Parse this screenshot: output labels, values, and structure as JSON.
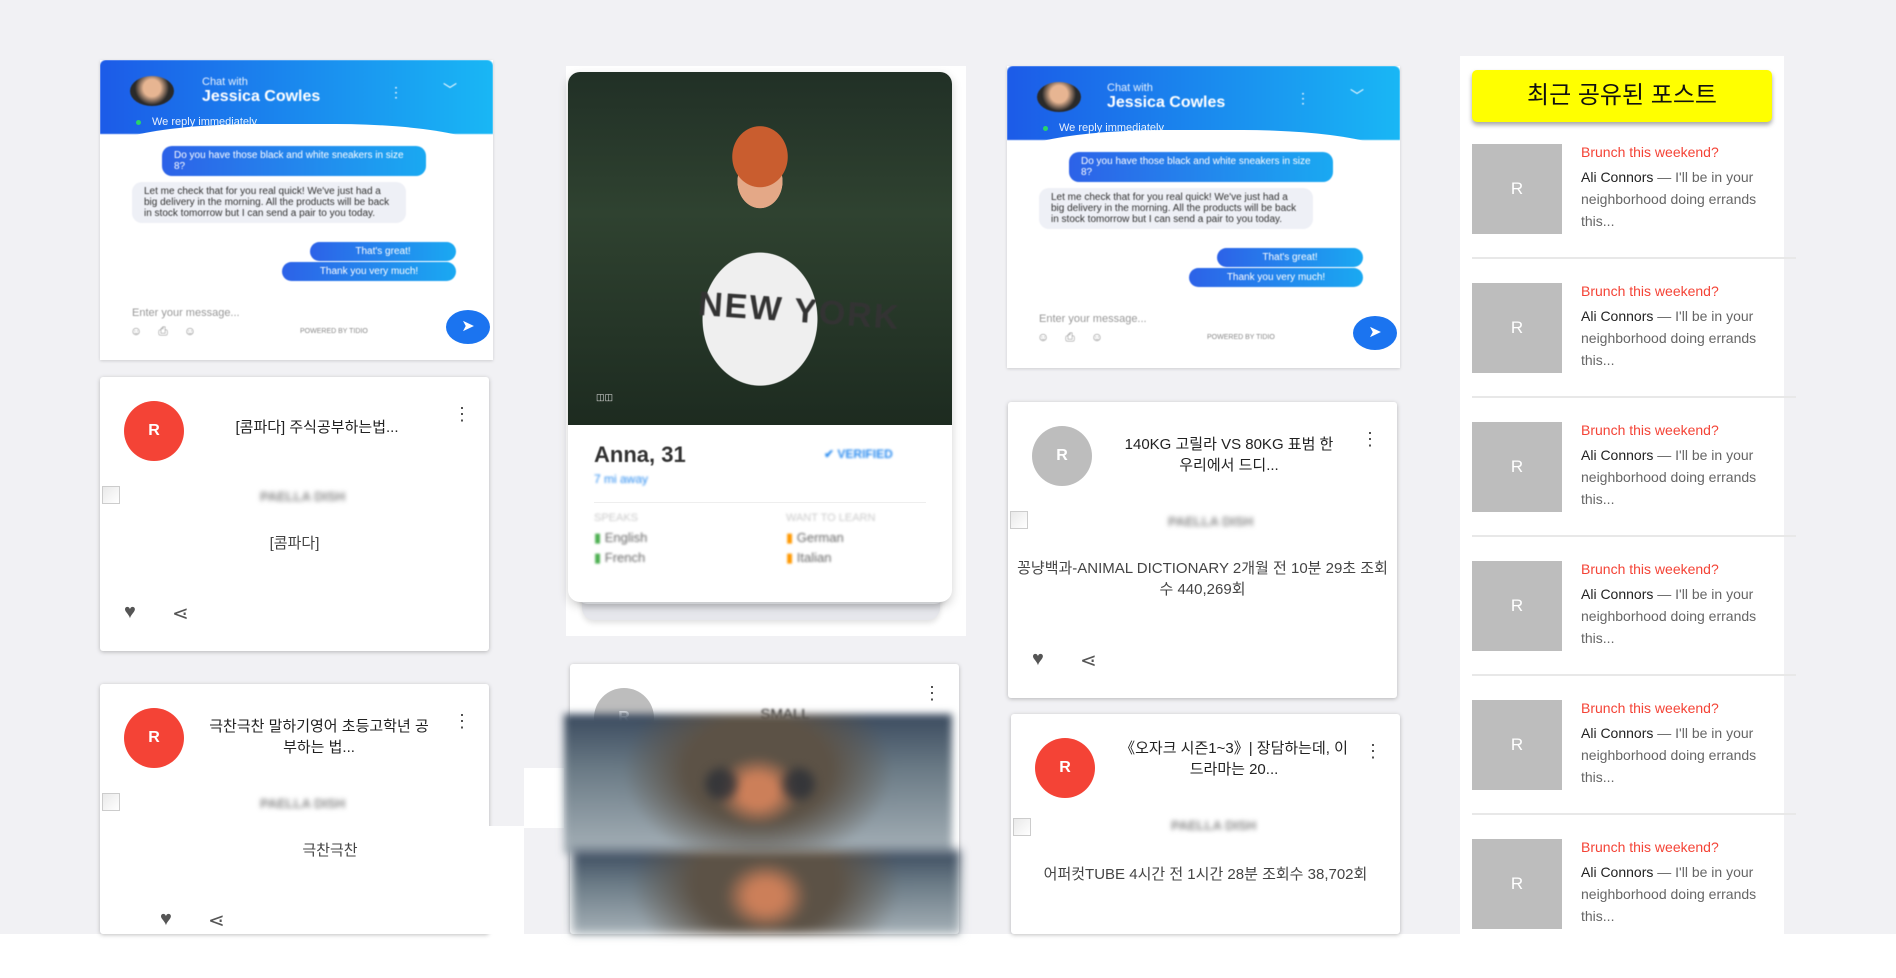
{
  "chat_widget": {
    "chat_with_label": "Chat with",
    "agent_name": "Jessica Cowles",
    "reply_status": "We reply immediately",
    "messages": [
      "Do you have those black and white sneakers in size 8?",
      "Let me check that for you real quick! We've just had a big delivery in the morning. All the products will be back in stock tomorrow but I can send a pair to you today.",
      "That's great!",
      "Thank you very much!"
    ],
    "input_placeholder": "Enter your message...",
    "powered_by": "POWERED BY TIDIO"
  },
  "posts": [
    {
      "avatar": "R",
      "title": "[콤파다] 주식공부하는법...",
      "image_alt": "PAELLA DISH",
      "text": "[콤파다]"
    },
    {
      "avatar": "R",
      "title": "극찬극찬 말하기영어 초등고학년 공부하는 법...",
      "image_alt": "PAELLA DISH",
      "text": "극찬극찬"
    },
    {
      "avatar": "R",
      "title": "140KG 고릴라 VS 80KG 표범 한 우리에서 드디...",
      "image_alt": "PAELLA DISH",
      "text": "꽁냥백과-ANIMAL DICTIONARY 2개월 전 10분 29초 조회수 440,269회"
    },
    {
      "avatar": "R",
      "title": "《오자크 시즌1~3》| 장담하는데, 이 드라마는 20...",
      "image_alt": "PAELLA DISH",
      "text": "어퍼컷TUBE 4시간 전 1시간 28분 조회수 38,702회"
    },
    {
      "avatar": "R",
      "title": "SMALL",
      "image_alt": "",
      "text": ""
    }
  ],
  "profile_card": {
    "name": "Anna, 31",
    "distance": "7 mi away",
    "verified": "VERIFIED",
    "photo_text": "NEW YORK",
    "speaks_label": "SPEAKS",
    "learn_label": "WANT TO LEARN",
    "speaks": [
      "English",
      "French"
    ],
    "learn": [
      "German",
      "Italian"
    ]
  },
  "recent_panel": {
    "header": "최근 공유된 포스트",
    "items": [
      {
        "thumb": "R",
        "title": "Brunch this weekend?",
        "author": "Ali Connors",
        "body": " — I'll be in your neighborhood doing errands this..."
      },
      {
        "thumb": "R",
        "title": "Brunch this weekend?",
        "author": "Ali Connors",
        "body": " — I'll be in your neighborhood doing errands this..."
      },
      {
        "thumb": "R",
        "title": "Brunch this weekend?",
        "author": "Ali Connors",
        "body": " — I'll be in your neighborhood doing errands this..."
      },
      {
        "thumb": "R",
        "title": "Brunch this weekend?",
        "author": "Ali Connors",
        "body": " — I'll be in your neighborhood doing errands this..."
      },
      {
        "thumb": "R",
        "title": "Brunch this weekend?",
        "author": "Ali Connors",
        "body": " — I'll be in your neighborhood doing errands this..."
      },
      {
        "thumb": "R",
        "title": "Brunch this weekend?",
        "author": "Ali Connors",
        "body": " — I'll be in your neighborhood doing errands this..."
      }
    ]
  },
  "colors": {
    "accent_red": "#f44336",
    "panel_header": "#ffff00",
    "chat_blue": "#1c5be8"
  }
}
